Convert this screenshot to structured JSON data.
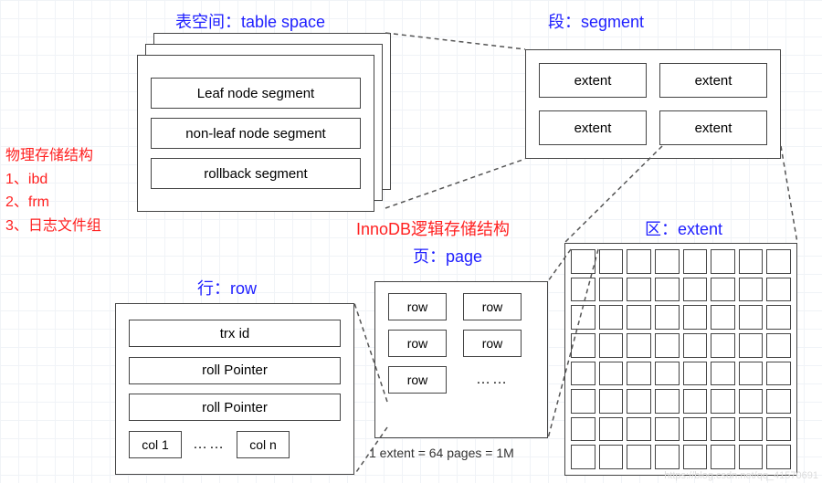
{
  "titles": {
    "tablespace": "表空间：table space",
    "segment": "段：segment",
    "extent": "区：extent",
    "page_combined": "页：page",
    "row": "行：row",
    "center": "InnoDB逻辑存储结构"
  },
  "physical": {
    "heading": "物理存储结构",
    "line1": "1、ibd",
    "line2": "2、frm",
    "line3": "3、日志文件组"
  },
  "tablespace_items": {
    "a": "Leaf node segment",
    "b": "non-leaf node segment",
    "c": "rollback segment"
  },
  "segment_cells": {
    "a": "extent",
    "b": "extent",
    "c": "extent",
    "d": "extent"
  },
  "page_rows": {
    "r": "row",
    "ellipsis": "……"
  },
  "row_box": {
    "trx": "trx id",
    "roll1": "roll Pointer",
    "roll2": "roll Pointer",
    "col1": "col 1",
    "coln": "col n",
    "ellipsis": "……"
  },
  "footnote": "1 extent = 64 pages = 1M",
  "watermark": "https://blog.csdn.net/qq_41570691"
}
